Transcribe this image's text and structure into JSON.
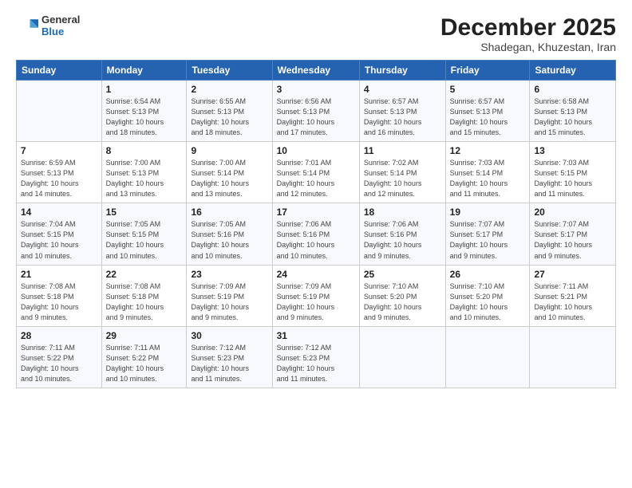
{
  "logo": {
    "general": "General",
    "blue": "Blue"
  },
  "title": "December 2025",
  "subtitle": "Shadegan, Khuzestan, Iran",
  "days_of_week": [
    "Sunday",
    "Monday",
    "Tuesday",
    "Wednesday",
    "Thursday",
    "Friday",
    "Saturday"
  ],
  "weeks": [
    [
      {
        "day": "",
        "info": ""
      },
      {
        "day": "1",
        "info": "Sunrise: 6:54 AM\nSunset: 5:13 PM\nDaylight: 10 hours\nand 18 minutes."
      },
      {
        "day": "2",
        "info": "Sunrise: 6:55 AM\nSunset: 5:13 PM\nDaylight: 10 hours\nand 18 minutes."
      },
      {
        "day": "3",
        "info": "Sunrise: 6:56 AM\nSunset: 5:13 PM\nDaylight: 10 hours\nand 17 minutes."
      },
      {
        "day": "4",
        "info": "Sunrise: 6:57 AM\nSunset: 5:13 PM\nDaylight: 10 hours\nand 16 minutes."
      },
      {
        "day": "5",
        "info": "Sunrise: 6:57 AM\nSunset: 5:13 PM\nDaylight: 10 hours\nand 15 minutes."
      },
      {
        "day": "6",
        "info": "Sunrise: 6:58 AM\nSunset: 5:13 PM\nDaylight: 10 hours\nand 15 minutes."
      }
    ],
    [
      {
        "day": "7",
        "info": "Sunrise: 6:59 AM\nSunset: 5:13 PM\nDaylight: 10 hours\nand 14 minutes."
      },
      {
        "day": "8",
        "info": "Sunrise: 7:00 AM\nSunset: 5:13 PM\nDaylight: 10 hours\nand 13 minutes."
      },
      {
        "day": "9",
        "info": "Sunrise: 7:00 AM\nSunset: 5:14 PM\nDaylight: 10 hours\nand 13 minutes."
      },
      {
        "day": "10",
        "info": "Sunrise: 7:01 AM\nSunset: 5:14 PM\nDaylight: 10 hours\nand 12 minutes."
      },
      {
        "day": "11",
        "info": "Sunrise: 7:02 AM\nSunset: 5:14 PM\nDaylight: 10 hours\nand 12 minutes."
      },
      {
        "day": "12",
        "info": "Sunrise: 7:03 AM\nSunset: 5:14 PM\nDaylight: 10 hours\nand 11 minutes."
      },
      {
        "day": "13",
        "info": "Sunrise: 7:03 AM\nSunset: 5:15 PM\nDaylight: 10 hours\nand 11 minutes."
      }
    ],
    [
      {
        "day": "14",
        "info": "Sunrise: 7:04 AM\nSunset: 5:15 PM\nDaylight: 10 hours\nand 10 minutes."
      },
      {
        "day": "15",
        "info": "Sunrise: 7:05 AM\nSunset: 5:15 PM\nDaylight: 10 hours\nand 10 minutes."
      },
      {
        "day": "16",
        "info": "Sunrise: 7:05 AM\nSunset: 5:16 PM\nDaylight: 10 hours\nand 10 minutes."
      },
      {
        "day": "17",
        "info": "Sunrise: 7:06 AM\nSunset: 5:16 PM\nDaylight: 10 hours\nand 10 minutes."
      },
      {
        "day": "18",
        "info": "Sunrise: 7:06 AM\nSunset: 5:16 PM\nDaylight: 10 hours\nand 9 minutes."
      },
      {
        "day": "19",
        "info": "Sunrise: 7:07 AM\nSunset: 5:17 PM\nDaylight: 10 hours\nand 9 minutes."
      },
      {
        "day": "20",
        "info": "Sunrise: 7:07 AM\nSunset: 5:17 PM\nDaylight: 10 hours\nand 9 minutes."
      }
    ],
    [
      {
        "day": "21",
        "info": "Sunrise: 7:08 AM\nSunset: 5:18 PM\nDaylight: 10 hours\nand 9 minutes."
      },
      {
        "day": "22",
        "info": "Sunrise: 7:08 AM\nSunset: 5:18 PM\nDaylight: 10 hours\nand 9 minutes."
      },
      {
        "day": "23",
        "info": "Sunrise: 7:09 AM\nSunset: 5:19 PM\nDaylight: 10 hours\nand 9 minutes."
      },
      {
        "day": "24",
        "info": "Sunrise: 7:09 AM\nSunset: 5:19 PM\nDaylight: 10 hours\nand 9 minutes."
      },
      {
        "day": "25",
        "info": "Sunrise: 7:10 AM\nSunset: 5:20 PM\nDaylight: 10 hours\nand 9 minutes."
      },
      {
        "day": "26",
        "info": "Sunrise: 7:10 AM\nSunset: 5:20 PM\nDaylight: 10 hours\nand 10 minutes."
      },
      {
        "day": "27",
        "info": "Sunrise: 7:11 AM\nSunset: 5:21 PM\nDaylight: 10 hours\nand 10 minutes."
      }
    ],
    [
      {
        "day": "28",
        "info": "Sunrise: 7:11 AM\nSunset: 5:22 PM\nDaylight: 10 hours\nand 10 minutes."
      },
      {
        "day": "29",
        "info": "Sunrise: 7:11 AM\nSunset: 5:22 PM\nDaylight: 10 hours\nand 10 minutes."
      },
      {
        "day": "30",
        "info": "Sunrise: 7:12 AM\nSunset: 5:23 PM\nDaylight: 10 hours\nand 11 minutes."
      },
      {
        "day": "31",
        "info": "Sunrise: 7:12 AM\nSunset: 5:23 PM\nDaylight: 10 hours\nand 11 minutes."
      },
      {
        "day": "",
        "info": ""
      },
      {
        "day": "",
        "info": ""
      },
      {
        "day": "",
        "info": ""
      }
    ]
  ]
}
